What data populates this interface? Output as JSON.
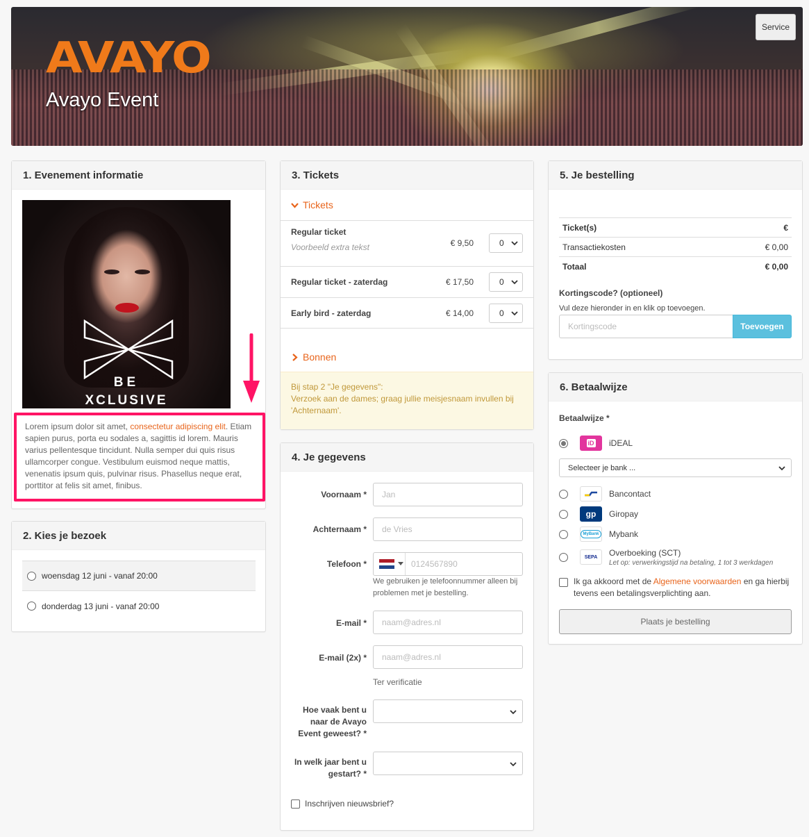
{
  "header": {
    "logo_text": "AVAYO",
    "event_title": "Avayo Event",
    "service_label": "Service"
  },
  "section1": {
    "title": "1. Evenement informatie",
    "poster_text_line1": "BE",
    "poster_text_line2": "XCLUSIVE",
    "description_before_link": "Lorem ipsum dolor sit amet, ",
    "description_link": "consectetur adipiscing elit",
    "description_after_link": ". Etiam sapien purus, porta eu sodales a, sagittis id lorem. Mauris varius pellentesque tincidunt. Nulla semper dui quis risus ullamcorper congue. Vestibulum euismod neque mattis, venenatis ipsum quis, pulvinar risus. Phasellus neque erat, porttitor at felis sit amet, finibus."
  },
  "section2": {
    "title": "2. Kies je bezoek",
    "options": [
      {
        "label": "woensdag 12 juni - vanaf 20:00"
      },
      {
        "label": "donderdag 13 juni - vanaf 20:00"
      }
    ]
  },
  "section3": {
    "title": "3. Tickets",
    "tickets_toggle": "Tickets",
    "tickets": [
      {
        "name": "Regular ticket",
        "subtitle": "Voorbeeld extra tekst",
        "price": "€ 9,50",
        "qty": "0"
      },
      {
        "name": "Regular ticket - zaterdag",
        "price": "€ 17,50",
        "qty": "0"
      },
      {
        "name": "Early bird - zaterdag",
        "price": "€ 14,00",
        "qty": "0"
      }
    ],
    "vouchers_toggle": "Bonnen",
    "notice_line1": "Bij stap 2 \"Je gegevens\":",
    "notice_line2": "Verzoek aan de dames; graag jullie meisjesnaam invullen bij 'Achternaam'."
  },
  "section4": {
    "title": "4. Je gegevens",
    "first_name_label": "Voornaam *",
    "first_name_placeholder": "Jan",
    "last_name_label": "Achternaam *",
    "last_name_placeholder": "de Vries",
    "phone_label": "Telefoon *",
    "phone_placeholder": "0124567890",
    "phone_help": "We gebruiken je telefoonnummer alleen bij problemen met je bestelling.",
    "email_label": "E-mail *",
    "email_placeholder": "naam@adres.nl",
    "email2_label": "E-mail (2x) *",
    "email2_placeholder": "naam@adres.nl",
    "email2_help": "Ter verificatie",
    "visits_label": "Hoe vaak bent u naar de Avayo Event geweest? *",
    "visits_value": "",
    "year_label": "In welk jaar bent u gestart? *",
    "year_value": "",
    "newsletter_label": "Inschrijven nieuwsbrief?"
  },
  "section5": {
    "title": "5. Je bestelling",
    "rows": [
      {
        "label": "Ticket(s)",
        "value": "€"
      },
      {
        "label": "Transactiekosten",
        "value": "€ 0,00"
      },
      {
        "label": "Totaal",
        "value": "€ 0,00"
      }
    ],
    "discount_label": "Kortingscode? (optioneel)",
    "discount_help": "Vul deze hieronder in en klik op toevoegen.",
    "discount_placeholder": "Kortingscode",
    "add_button": "Toevoegen"
  },
  "section6": {
    "title": "6. Betaalwijze",
    "method_label": "Betaalwijze *",
    "methods": [
      {
        "name": "iDEAL",
        "logo": "iD",
        "logo_color": "#e2359d"
      },
      {
        "name": "Bancontact",
        "logo": "bc",
        "logo_color": "#1e4aa0"
      },
      {
        "name": "Giropay",
        "logo": "gp",
        "logo_color": "#003a7d"
      },
      {
        "name": "Mybank",
        "logo": "MyBank",
        "logo_color": "#1a9fd6"
      },
      {
        "name": "Overboeking (SCT)",
        "note": "Let op: verwerkingstijd na betaling, 1 tot 3 werkdagen",
        "logo": "SEPA",
        "logo_color": "#10298e"
      }
    ],
    "bank_select": "Selecteer je bank ...",
    "terms_before": "Ik ga akkoord met de ",
    "terms_link": "Algemene voorwaarden",
    "terms_after": " en ga hierbij tevens een betalingsverplichting aan.",
    "submit_button": "Plaats je bestelling"
  },
  "colors": {
    "accent": "#e8641b",
    "highlight_border": "#ff1465",
    "primary_button": "#5bc0de",
    "notice_bg": "#fcf8e3",
    "notice_text": "#c0983a"
  }
}
